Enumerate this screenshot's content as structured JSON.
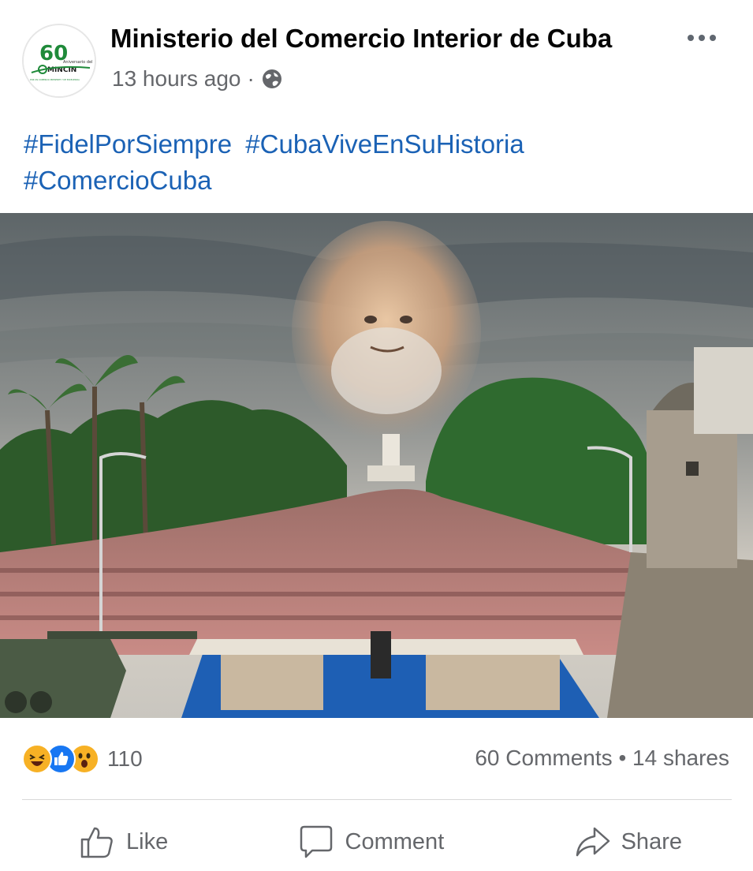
{
  "post": {
    "author": "Ministerio del Comercio Interior de Cuba",
    "timestamp": "13 hours ago",
    "separator": "·",
    "privacy_icon": "globe-icon",
    "avatar": {
      "number": "60",
      "line1": "Aniversario del",
      "brand": "MINCIN",
      "tagline": "POR UN COMERCIO PRESENTE Y DE EXCELENCIA"
    },
    "hashtags": [
      "#FidelPorSiempre",
      "#CubaViveEnSuHistoria",
      "#ComercioCuba"
    ]
  },
  "stats": {
    "reaction_icons": [
      "haha-reaction-icon",
      "like-reaction-icon",
      "wow-reaction-icon"
    ],
    "reaction_count": "110",
    "comments": "60 Comments",
    "bullet": "•",
    "shares": "14 shares"
  },
  "actions": {
    "like": "Like",
    "comment": "Comment",
    "share": "Share"
  },
  "colors": {
    "hashtag": "#1b62b5",
    "secondary_text": "#65676b",
    "like_blue": "#1877f2",
    "reaction_yellow": "#f7b125"
  }
}
